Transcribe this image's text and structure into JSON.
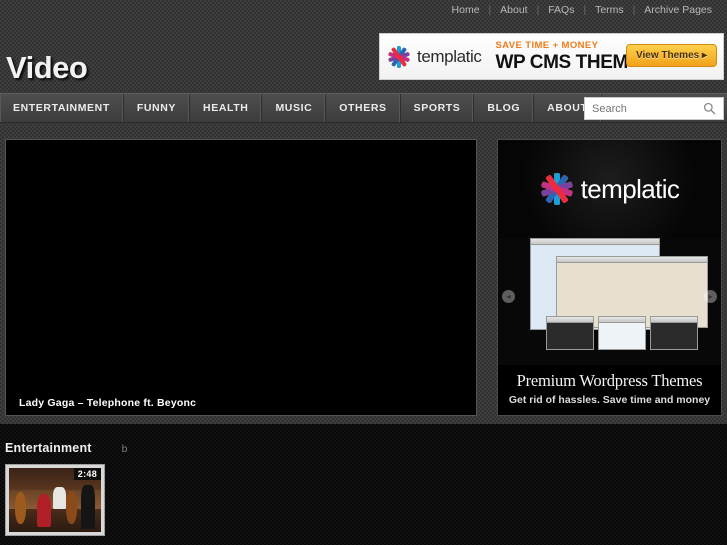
{
  "topbar": {
    "links": [
      "Home",
      "About",
      "FAQs",
      "Terms",
      "Archive Pages"
    ],
    "separator": "|"
  },
  "header": {
    "logo": "Video",
    "banner": {
      "logo_text": "templatic",
      "tagline": "SAVE TIME + MONEY",
      "headline": "WP CMS THEM",
      "button_label": "View Themes ▸",
      "accent_color": "#f07b1a",
      "button_color": "#f2a11a"
    }
  },
  "nav": {
    "items": [
      "ENTERTAINMENT",
      "FUNNY",
      "HEALTH",
      "MUSIC",
      "OTHERS",
      "SPORTS",
      "BLOG",
      "ABOUT"
    ],
    "search": {
      "placeholder": "Search",
      "value": "",
      "icon": "search-icon"
    }
  },
  "main": {
    "video": {
      "caption": "Lady Gaga – Telephone ft. Beyonc",
      "background": "#000000"
    }
  },
  "sidebar": {
    "ad": {
      "logo_text": "templatic",
      "title": "Premium Wordpress Themes",
      "subtitle": "Get rid of hassles. Save time and money",
      "prev_arrow": "◂",
      "next_arrow": "▸",
      "background": "#080808"
    }
  },
  "section": {
    "title": "Entertainment",
    "extra": "b",
    "items": [
      {
        "duration": "2:48",
        "thumb_name": "orchestra-thumbnail"
      }
    ]
  }
}
